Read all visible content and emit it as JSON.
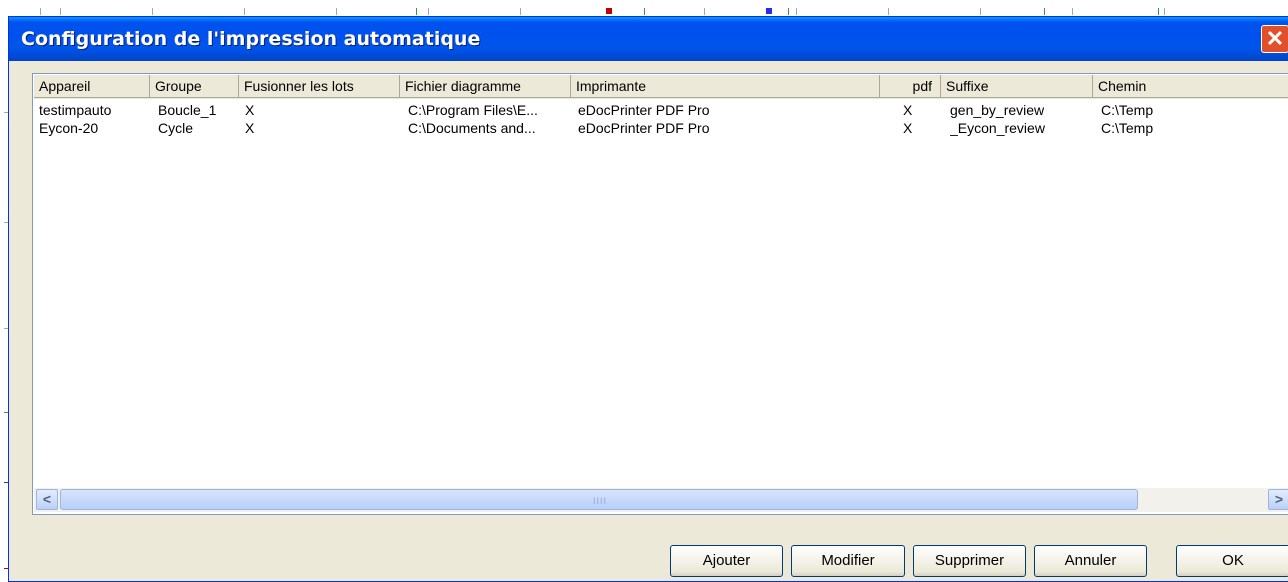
{
  "window": {
    "title": "Configuration de l'impression automatique",
    "close_glyph": "✕"
  },
  "table": {
    "columns": [
      "Appareil",
      "Groupe",
      "Fusionner les lots",
      "Fichier diagramme",
      "Imprimante",
      "pdf",
      "Suffixe",
      "Chemin"
    ],
    "rows": [
      [
        "testimpauto",
        "Boucle_1",
        "X",
        "C:\\Program Files\\E...",
        "eDocPrinter PDF Pro",
        "X",
        "gen_by_review",
        "C:\\Temp"
      ],
      [
        "Eycon-20",
        "Cycle",
        "X",
        "C:\\Documents and...",
        "eDocPrinter PDF Pro",
        "X",
        "_Eycon_review",
        "C:\\Temp"
      ]
    ]
  },
  "scrollbar": {
    "left_arrow": "<",
    "right_arrow": ">",
    "grip": "IIII"
  },
  "buttons": {
    "add": "Ajouter",
    "edit": "Modifier",
    "delete": "Supprimer",
    "cancel": "Annuler",
    "ok": "OK"
  },
  "colors": {
    "titlebar": "#0054e3",
    "dialog_bg": "#ece9d8",
    "close_button": "#e2502a"
  }
}
